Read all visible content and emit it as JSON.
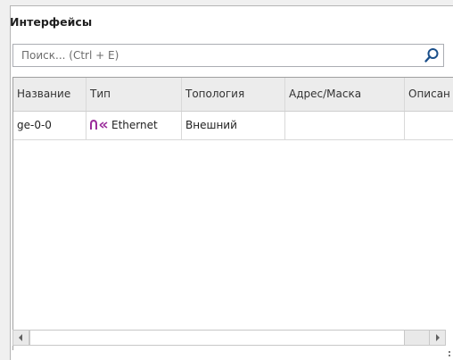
{
  "panel": {
    "title": "Интерфейсы"
  },
  "search": {
    "placeholder": "Поиск... (Ctrl + E)",
    "icon": "search-icon"
  },
  "table": {
    "columns": [
      "Название",
      "Тип",
      "Топология",
      "Адрес/Маска",
      "Описан"
    ],
    "rows": [
      {
        "name": "ge-0-0",
        "type": "Ethernet",
        "type_icon": "ethernet-icon",
        "topology": "Внешний",
        "address": "",
        "description": ""
      }
    ]
  },
  "colors": {
    "ethernet_icon": "#9b2d9b",
    "header_bg": "#ececec",
    "border": "#a0a0a0"
  }
}
